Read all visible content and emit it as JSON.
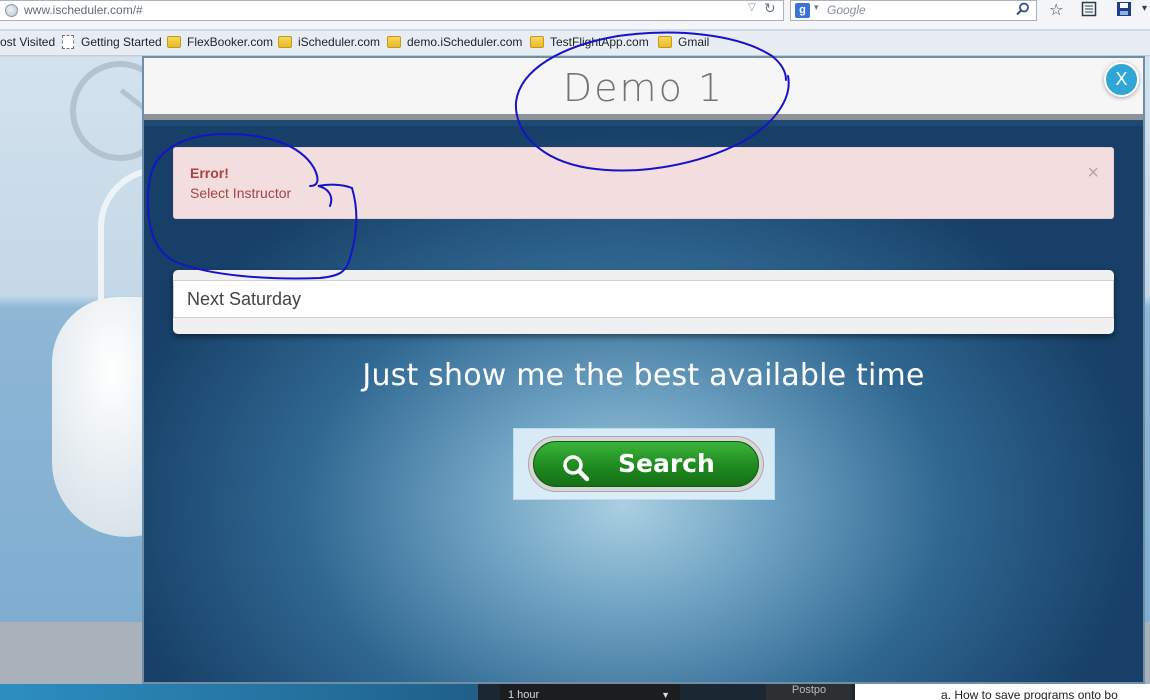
{
  "browser": {
    "url": "www.ischeduler.com/#",
    "search_placeholder": "Google",
    "search_engine_badge": "g",
    "icons": [
      "globe-icon",
      "dropdown-icon",
      "reload-icon",
      "search-go-icon",
      "star-icon",
      "bookmarks-list-icon",
      "save-icon"
    ],
    "bookmarks": [
      {
        "label": "ost Visited",
        "icon": "none"
      },
      {
        "label": "Getting Started",
        "icon": "page"
      },
      {
        "label": "FlexBooker.com",
        "icon": "folder"
      },
      {
        "label": "iScheduler.com",
        "icon": "folder"
      },
      {
        "label": "demo.iScheduler.com",
        "icon": "folder"
      },
      {
        "label": "TestFlightApp.com",
        "icon": "folder"
      },
      {
        "label": "Gmail",
        "icon": "folder"
      }
    ]
  },
  "modal": {
    "title": "Demo 1",
    "close_label": "X",
    "alert": {
      "title": "Error!",
      "message": "Select Instructor",
      "close_symbol": "×"
    },
    "date_input": {
      "value": "Next Saturday"
    },
    "tagline": "Just show me the best available time",
    "search_button": {
      "label": "Search",
      "color": "#1f8a1f"
    }
  },
  "bottom_strip": {
    "duration_select": "1 hour",
    "postpone_label": "Postpo",
    "doc_snippet": "a.     How to save programs onto bo"
  },
  "colors": {
    "alert_bg": "#f2dede",
    "alert_text": "#a94442",
    "modal_body": "#1c4a73",
    "annotation_ink": "#1414c8"
  }
}
